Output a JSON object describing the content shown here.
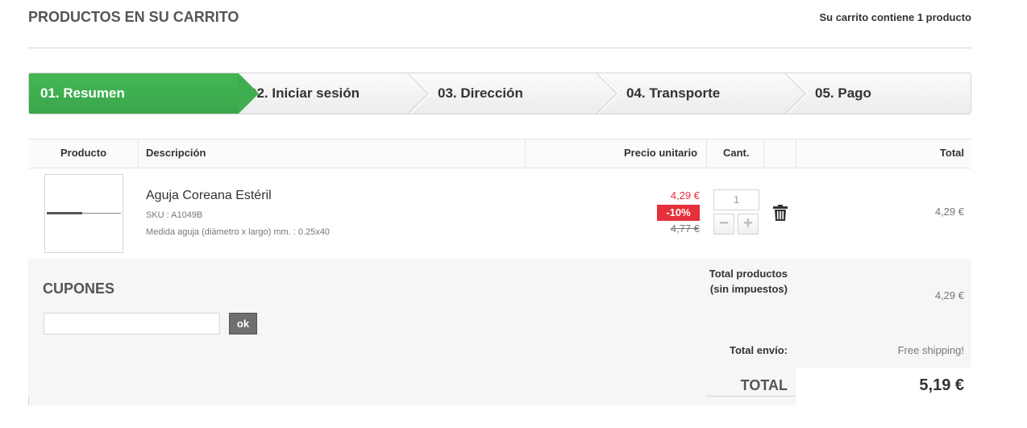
{
  "header": {
    "title": "PRODUCTOS EN SU CARRITO",
    "cart_count": "Su carrito contiene 1 producto"
  },
  "steps": [
    {
      "label": "01. Resumen",
      "active": true
    },
    {
      "label": "02. Iniciar sesión",
      "active": false
    },
    {
      "label": "03. Dirección",
      "active": false
    },
    {
      "label": "04. Transporte",
      "active": false
    },
    {
      "label": "05. Pago",
      "active": false
    }
  ],
  "table": {
    "headers": {
      "product": "Producto",
      "description": "Descripción",
      "unit_price": "Precio unitario",
      "qty": "Cant.",
      "total": "Total"
    }
  },
  "item": {
    "name": "Aguja Coreana Estéril",
    "sku": "SKU : A1049B",
    "attribute": "Medida aguja (diámetro x largo) mm. : 0.25x40",
    "price_new": "4,29 €",
    "discount": "-10%",
    "price_old": "4,77 €",
    "quantity": "1",
    "minus": "−",
    "plus": "+",
    "total": "4,29 €"
  },
  "coupons": {
    "title": "CUPONES",
    "input_value": "",
    "ok_label": "ok"
  },
  "summary": {
    "total_products_label": "Total productos (sin impuestos)",
    "total_products_value": "4,29 €",
    "shipping_label": "Total envío:",
    "shipping_value": "Free shipping!",
    "total_label": "TOTAL",
    "total_value": "5,19 €"
  },
  "colors": {
    "active_step": "#43b754",
    "discount": "#e6303b"
  }
}
